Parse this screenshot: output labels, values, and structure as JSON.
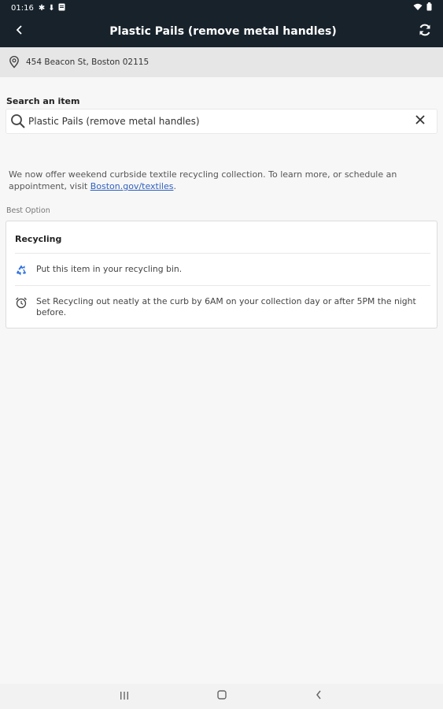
{
  "status_bar": {
    "time": "01:16",
    "icons": [
      "gear-icon",
      "download-icon",
      "clipboard-icon"
    ],
    "right_icons": [
      "wifi-icon",
      "battery-icon"
    ]
  },
  "app_bar": {
    "title": "Plastic Pails (remove metal handles)",
    "back_icon": "back-chevron-icon",
    "refresh_icon": "refresh-icon"
  },
  "address": {
    "text": "454 Beacon St, Boston 02115",
    "icon": "location-pin-icon"
  },
  "search": {
    "label": "Search an item",
    "value": "Plastic Pails (remove metal handles)",
    "search_icon": "search-icon",
    "clear_icon": "close-icon"
  },
  "notice": {
    "text": "We now offer weekend curbside textile recycling collection. To learn more, or schedule an appointment, visit",
    "link_text": "Boston.gov/textiles",
    "suffix": "."
  },
  "best_option": {
    "label": "Best Option",
    "card": {
      "title": "Recycling",
      "rows": [
        {
          "icon": "recycle-icon",
          "text": "Put this item in your recycling bin."
        },
        {
          "icon": "alarm-clock-icon",
          "text": "Set Recycling out neatly at the curb by 6AM on your collection day or after 5PM the night before."
        }
      ]
    }
  },
  "colors": {
    "app_bar": "#17222b",
    "address_bar": "#e6e6e6",
    "link": "#2f5fbf",
    "recycle_blue": "#2b6de0"
  },
  "nav_bar": {
    "icons": [
      "recents-icon",
      "home-icon",
      "back-icon"
    ]
  }
}
